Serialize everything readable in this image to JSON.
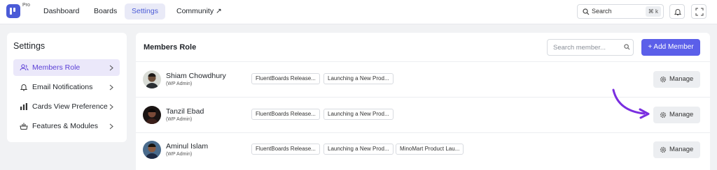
{
  "topbar": {
    "pro_badge": "Pro",
    "nav": [
      {
        "label": "Dashboard"
      },
      {
        "label": "Boards"
      },
      {
        "label": "Settings",
        "active": true
      },
      {
        "label": "Community ↗"
      }
    ],
    "search": {
      "label": "Search",
      "shortcut": "⌘ k"
    },
    "icons": [
      "bell-icon",
      "fullscreen-icon"
    ]
  },
  "sidebar": {
    "title": "Settings",
    "items": [
      {
        "label": "Members Role",
        "icon": "members-icon",
        "active": true
      },
      {
        "label": "Email Notifications",
        "icon": "bell-icon"
      },
      {
        "label": "Cards View Preference",
        "icon": "bar-chart-icon"
      },
      {
        "label": "Features & Modules",
        "icon": "modules-icon"
      }
    ]
  },
  "main": {
    "title": "Members Role",
    "search_placeholder": "Search member...",
    "add_button": "+ Add Member",
    "manage_label": "Manage",
    "members": [
      {
        "name": "Shiam Chowdhury",
        "role": "(WP Admin)",
        "boards": [
          "FluentBoards Release...",
          "Launching a New Prod..."
        ]
      },
      {
        "name": "Tanzil Ebad",
        "role": "(WP Admin)",
        "boards": [
          "FluentBoards Release...",
          "Launching a New Prod..."
        ]
      },
      {
        "name": "Aminul Islam",
        "role": "(WP Admin)",
        "boards": [
          "FluentBoards Release...",
          "Launching a New Prod...",
          "MinoMart Product Lau..."
        ]
      }
    ]
  },
  "colors": {
    "accent": "#5b5fe9",
    "arrow": "#7a2ee0",
    "active_bg": "#ebe8fa"
  }
}
